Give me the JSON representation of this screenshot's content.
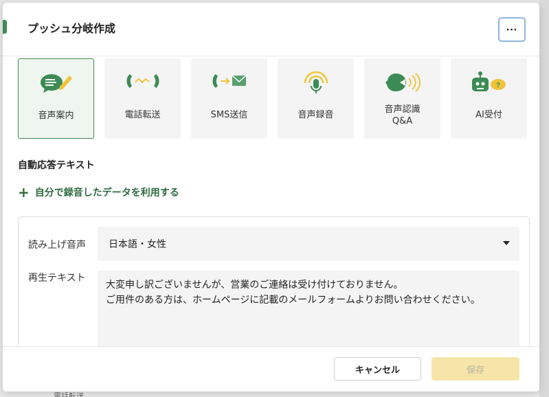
{
  "background": {
    "bottom_text": "電話転送"
  },
  "modal": {
    "title": "プッシュ分岐作成",
    "more_label": "⋯",
    "actions": [
      {
        "label": "音声案内",
        "icon": "speech-bubble-pencil-icon",
        "selected": true
      },
      {
        "label": "電話転送",
        "icon": "phone-transfer-icon",
        "selected": false
      },
      {
        "label": "SMS送信",
        "icon": "phone-sms-icon",
        "selected": false
      },
      {
        "label": "音声録音",
        "icon": "microphone-icon",
        "selected": false
      },
      {
        "label": "音声認識\nQ&A",
        "icon": "voice-recognition-icon",
        "selected": false
      },
      {
        "label": "AI受付",
        "icon": "robot-icon",
        "selected": false
      }
    ],
    "section_title": "自動応答テキスト",
    "add_recording_label": "自分で録音したデータを利用する",
    "voice_label": "読み上げ音声",
    "voice_value": "日本語・女性",
    "text_label": "再生テキスト",
    "text_value": "大変申し訳ございませんが、営業のご連絡は受け付けておりません。\nご用件のある方は、ホームページに記載のメールフォームよりお問い合わせください。",
    "cancel_label": "キャンセル",
    "save_label": "保存"
  },
  "colors": {
    "accent": "#3d8b54",
    "save_disabled": "#f6e5a8",
    "icon_yellow": "#f0c43a"
  }
}
